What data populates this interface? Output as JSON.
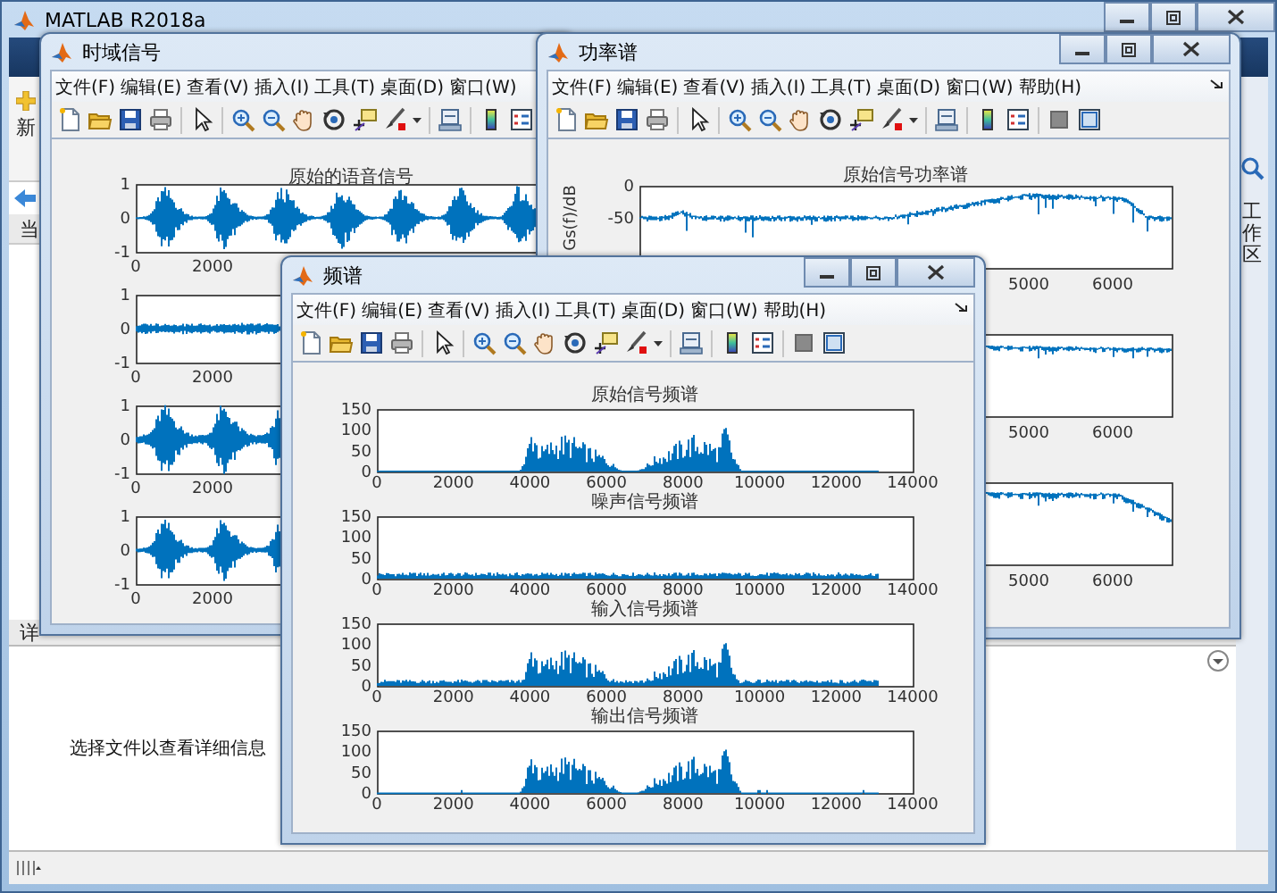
{
  "main_window": {
    "title": "MATLAB R2018a",
    "toolstrip_label": "新",
    "folder_header": "当",
    "details_header": "详",
    "details_message": "选择文件以查看详细信息",
    "workspace_tab": "工作区"
  },
  "figures": [
    {
      "title": "时域信号",
      "menus": [
        "文件(F)",
        "编辑(E)",
        "查看(V)",
        "插入(I)",
        "工具(T)",
        "桌面(D)",
        "窗口(W)"
      ],
      "plots": [
        {
          "title": "原始的语音信号",
          "kind": "speech",
          "xticks": [
            "0",
            "2000"
          ],
          "yticks": [
            "1",
            "0",
            "-1"
          ]
        },
        {
          "kind": "noise",
          "xticks": [
            "0",
            "2000"
          ],
          "yticks": [
            "1",
            "0",
            "-1"
          ]
        },
        {
          "kind": "noisy_speech",
          "xticks": [
            "0",
            "2000"
          ],
          "yticks": [
            "1",
            "0",
            "-1"
          ]
        },
        {
          "kind": "filtered_speech",
          "xticks": [
            "0",
            "2000"
          ],
          "yticks": [
            "1",
            "0",
            "-1"
          ]
        }
      ]
    },
    {
      "title": "功率谱",
      "menus": [
        "文件(F)",
        "编辑(E)",
        "查看(V)",
        "插入(I)",
        "工具(T)",
        "桌面(D)",
        "窗口(W)",
        "帮助(H)"
      ],
      "plots": [
        {
          "title": "原始信号功率谱",
          "ylabel": "Gs(f)/dB",
          "kind": "power",
          "xticks": [
            "5000",
            "6000"
          ],
          "yticks": [
            "0",
            "-50"
          ]
        },
        {
          "kind": "power_flat",
          "xticks": [
            "5000",
            "6000"
          ]
        },
        {
          "kind": "power_rolloff",
          "xticks": [
            "5000",
            "6000"
          ]
        }
      ]
    },
    {
      "title": "频谱",
      "menus": [
        "文件(F)",
        "编辑(E)",
        "查看(V)",
        "插入(I)",
        "工具(T)",
        "桌面(D)",
        "窗口(W)",
        "帮助(H)"
      ],
      "plots": [
        {
          "title": "原始信号频谱",
          "kind": "spectrum",
          "xticks": [
            "0",
            "2000",
            "4000",
            "6000",
            "8000",
            "10000",
            "12000",
            "14000"
          ],
          "yticks": [
            "150",
            "100",
            "50",
            "0"
          ]
        },
        {
          "title": "噪声信号频谱",
          "kind": "noise_spectrum",
          "xticks": [
            "0",
            "2000",
            "4000",
            "6000",
            "8000",
            "10000",
            "12000",
            "14000"
          ],
          "yticks": [
            "150",
            "100",
            "50",
            "0"
          ]
        },
        {
          "title": "输入信号频谱",
          "kind": "input_spectrum",
          "xticks": [
            "0",
            "2000",
            "4000",
            "6000",
            "8000",
            "10000",
            "12000",
            "14000"
          ],
          "yticks": [
            "150",
            "100",
            "50",
            "0"
          ]
        },
        {
          "title": "输出信号频谱",
          "kind": "output_spectrum",
          "xticks": [
            "0",
            "2000",
            "4000",
            "6000",
            "8000",
            "10000",
            "12000",
            "14000"
          ],
          "yticks": [
            "150",
            "100",
            "50",
            "0"
          ]
        }
      ]
    }
  ]
}
